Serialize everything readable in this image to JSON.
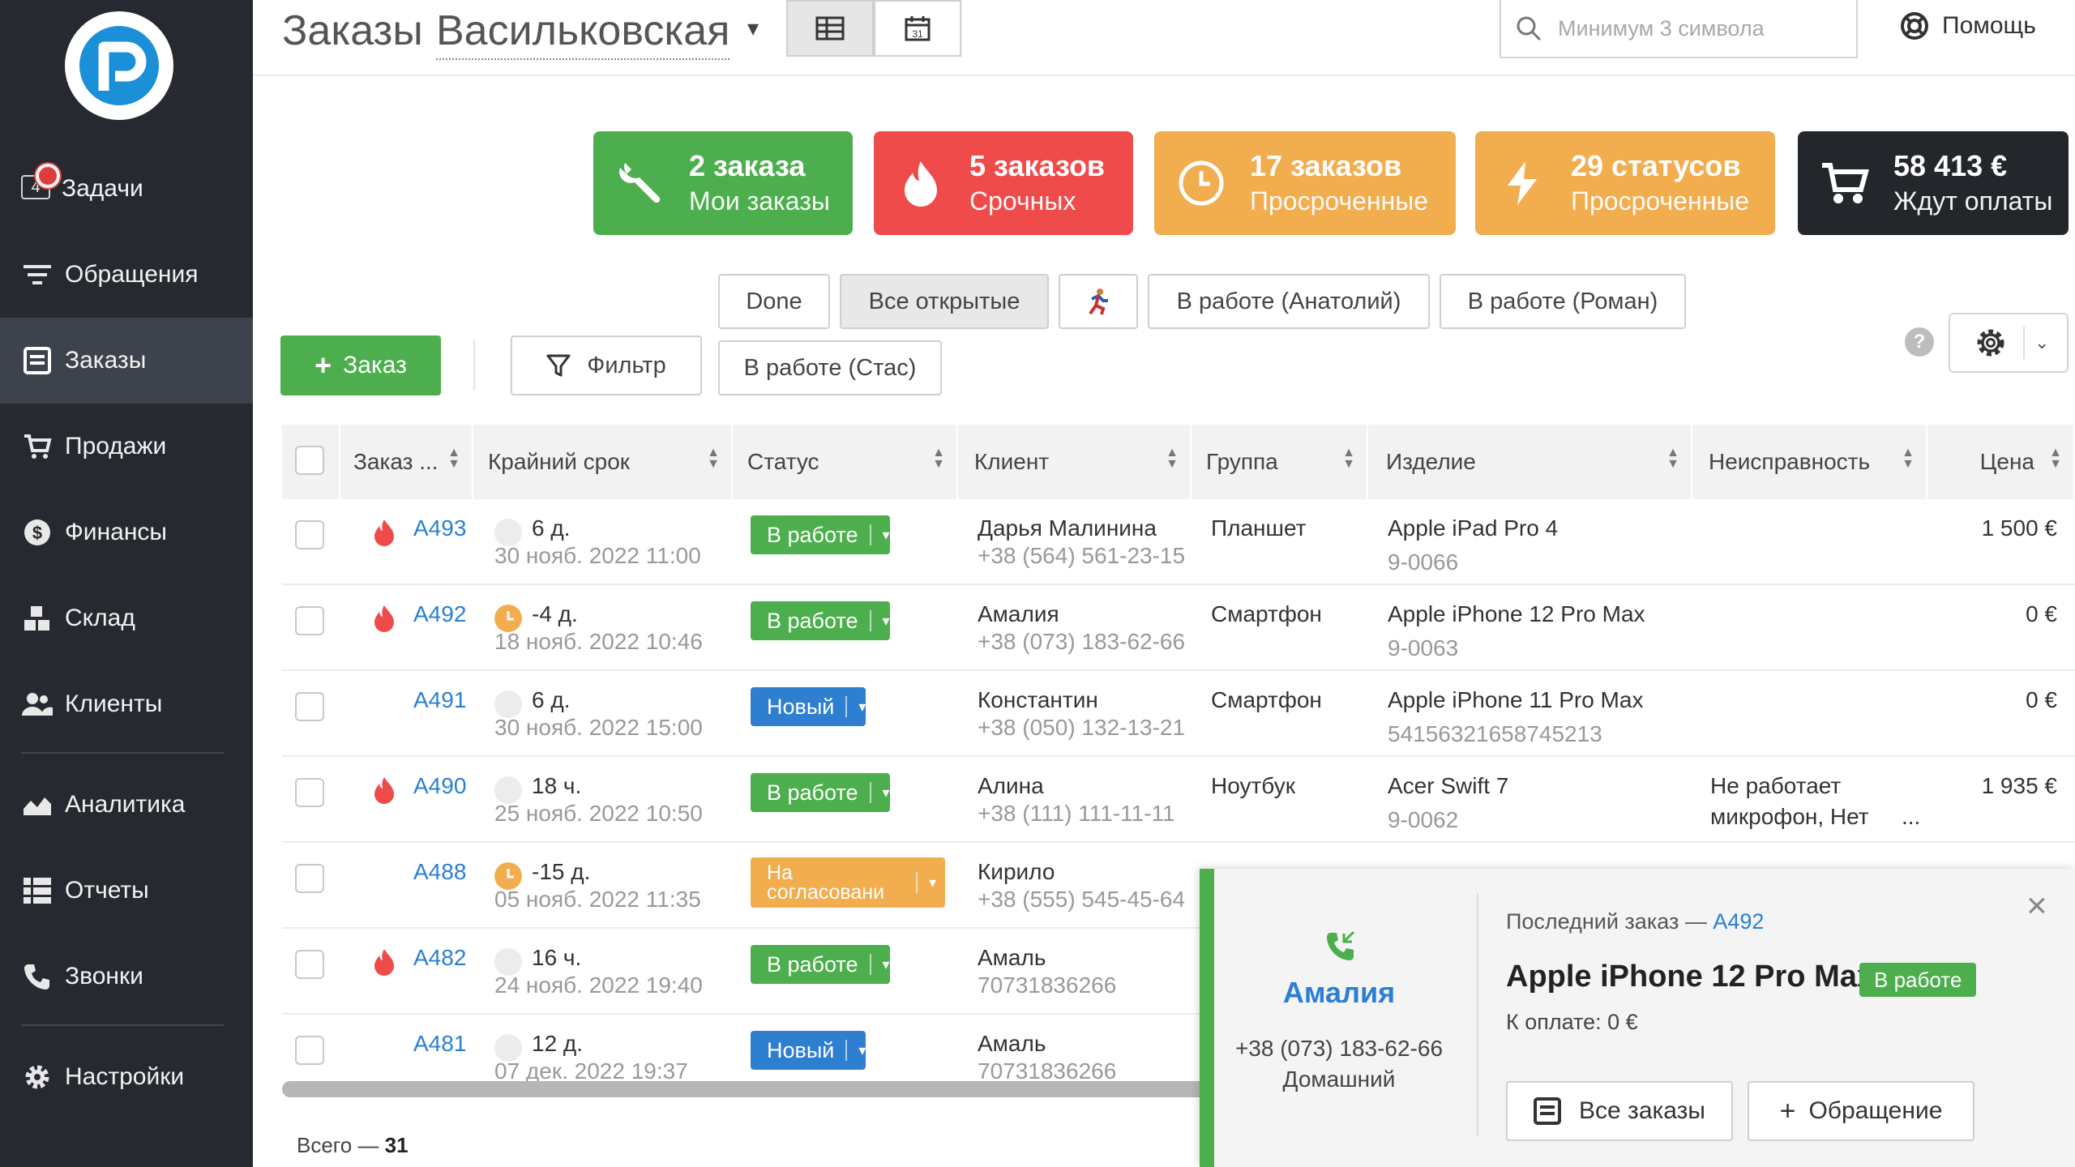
{
  "sidebar": {
    "tasks_count": "4",
    "items": [
      {
        "label": "Задачи",
        "icon": "task-icon"
      },
      {
        "label": "Обращения",
        "icon": "filter-lines-icon"
      },
      {
        "label": "Заказы",
        "icon": "orders-icon"
      },
      {
        "label": "Продажи",
        "icon": "cart-icon"
      },
      {
        "label": "Финансы",
        "icon": "dollar-icon"
      },
      {
        "label": "Склад",
        "icon": "boxes-icon"
      },
      {
        "label": "Клиенты",
        "icon": "people-icon"
      },
      {
        "label": "Аналитика",
        "icon": "chart-icon"
      },
      {
        "label": "Отчеты",
        "icon": "list-icon"
      },
      {
        "label": "Звонки",
        "icon": "phone-icon"
      },
      {
        "label": "Настройки",
        "icon": "gear-icon"
      }
    ]
  },
  "header": {
    "title": "Заказы",
    "branch": "Васильковская",
    "search_placeholder": "Минимум 3 символа",
    "help": "Помощь"
  },
  "cards": [
    {
      "line1": "2 заказа",
      "line2": "Мои заказы",
      "color": "#4cae4c"
    },
    {
      "line1": "5 заказов",
      "line2": "Срочных",
      "color": "#ef4b4b"
    },
    {
      "line1": "17 заказов",
      "line2": "Просроченные",
      "color": "#f2ad4e"
    },
    {
      "line1": "29 статусов",
      "line2": "Просроченные",
      "color": "#f2ad4e"
    },
    {
      "line1": "58 413 €",
      "line2": "Ждут оплаты",
      "color": "#23262b"
    }
  ],
  "tabs": {
    "done": "Done",
    "all_open": "Все открытые",
    "anatoliy": "В работе (Анатолий)",
    "roman": "В работе (Роман)",
    "stas": "В работе (Стас)"
  },
  "toolbar": {
    "new_order": "Заказ",
    "filter": "Фильтр"
  },
  "table": {
    "columns": [
      "Заказ ...",
      "Крайний срок",
      "Статус",
      "Клиент",
      "Группа",
      "Изделие",
      "Неисправность",
      "Цена"
    ],
    "rows": [
      {
        "id": "A493",
        "urgent": true,
        "deadline": "6 д.",
        "date": "30 нояб. 2022 11:00",
        "overdue": false,
        "status": "В работе",
        "status_color": "#4cae4c",
        "client": "Дарья Малинина",
        "phone": "+38 (564) 561-23-15",
        "group": "Планшет",
        "device": "Apple iPad Pro 4",
        "serial": "9-0066",
        "issue": "",
        "price": "1 500 €"
      },
      {
        "id": "A492",
        "urgent": true,
        "deadline": "-4 д.",
        "date": "18 нояб. 2022 10:46",
        "overdue": true,
        "status": "В работе",
        "status_color": "#4cae4c",
        "client": "Амалия",
        "phone": "+38 (073) 183-62-66",
        "group": "Смартфон",
        "device": "Apple iPhone 12 Pro Max",
        "serial": "9-0063",
        "issue": "",
        "price": "0 €"
      },
      {
        "id": "A491",
        "urgent": false,
        "deadline": "6 д.",
        "date": "30 нояб. 2022 15:00",
        "overdue": false,
        "status": "Новый",
        "status_color": "#2f7fd0",
        "client": "Константин",
        "phone": "+38 (050) 132-13-21",
        "group": "Смартфон",
        "device": "Apple iPhone 11 Pro Max",
        "serial": "54156321658745213",
        "issue": "",
        "price": "0 €"
      },
      {
        "id": "A490",
        "urgent": true,
        "deadline": "18 ч.",
        "date": "25 нояб. 2022 10:50",
        "overdue": false,
        "status": "В работе",
        "status_color": "#4cae4c",
        "client": "Алина",
        "phone": "+38 (111) 111-11-11",
        "group": "Ноутбук",
        "device": "Acer Swift 7",
        "serial": "9-0062",
        "issue": "Не работает",
        "issue2": "микрофон, Нет",
        "issue_more": "...",
        "price": "1 935 €"
      },
      {
        "id": "A488",
        "urgent": false,
        "deadline": "-15 д.",
        "date": "05 нояб. 2022 11:35",
        "overdue": true,
        "status": "На согласовани",
        "status_color": "#f2ad4e",
        "client": "Кирило",
        "phone": "+38 (555) 545-45-64",
        "group": "",
        "device": "",
        "serial": "",
        "issue": "",
        "price": ""
      },
      {
        "id": "A482",
        "urgent": true,
        "deadline": "16 ч.",
        "date": "24 нояб. 2022 19:40",
        "overdue": false,
        "status": "В работе",
        "status_color": "#4cae4c",
        "client": "Амаль",
        "phone": "70731836266",
        "group": "",
        "device": "",
        "serial": "",
        "issue": "",
        "price": ""
      },
      {
        "id": "A481",
        "urgent": false,
        "deadline": "12 д.",
        "date": "07 дек. 2022 19:37",
        "overdue": false,
        "status": "Новый",
        "status_color": "#2f7fd0",
        "client": "Амаль",
        "phone": "70731836266",
        "group": "",
        "device": "",
        "serial": "",
        "issue": "",
        "price": ""
      }
    ],
    "total_label": "Всего —",
    "total_value": "31"
  },
  "popup": {
    "name": "Амалия",
    "phone": "+38 (073) 183-62-66",
    "phone_type": "Домашний",
    "last_order_label": "Последний заказ —",
    "last_order_id": "A492",
    "device": "Apple iPhone 12 Pro Max",
    "status": "В работе",
    "pay": "К оплате: 0 €",
    "btn_orders": "Все заказы",
    "btn_appeal": "Обращение"
  }
}
